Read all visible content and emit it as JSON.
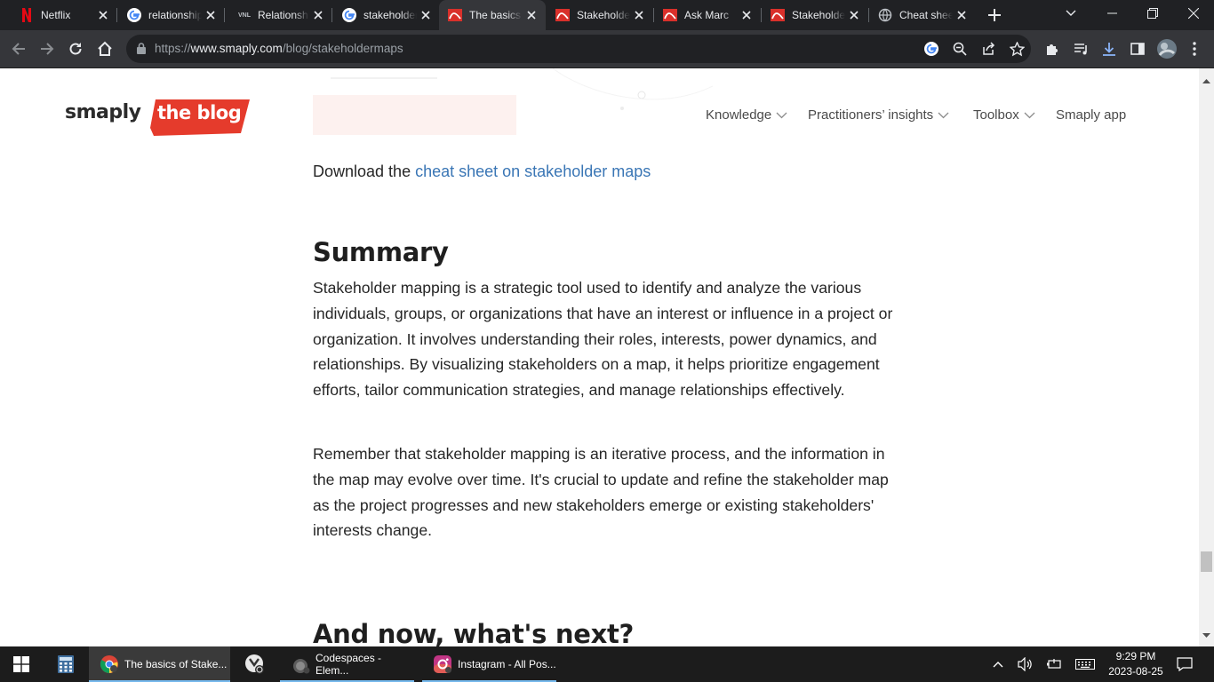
{
  "browser": {
    "tabs": [
      {
        "label": "Netflix",
        "icon": "netflix-icon"
      },
      {
        "label": "relationship",
        "icon": "google-icon"
      },
      {
        "label": "Relationship",
        "icon": "vnl-icon"
      },
      {
        "label": "stakeholder",
        "icon": "google-icon"
      },
      {
        "label": "The basics",
        "icon": "smaply-icon"
      },
      {
        "label": "Stakeholder",
        "icon": "smaply-icon"
      },
      {
        "label": "Ask Marc",
        "icon": "smaply-icon"
      },
      {
        "label": "Stakeholder",
        "icon": "smaply-icon"
      },
      {
        "label": "Cheat sheet",
        "icon": "globe-icon"
      }
    ],
    "vnl_badge": "VNL",
    "active_tab_index": 4,
    "url_prefix": "https://",
    "url_domain": "www.smaply.com",
    "url_path": "/blog/stakeholdermaps"
  },
  "site": {
    "logo_word": "smaply",
    "logo_badge": "the blog",
    "brand_color": "#e53b2c",
    "nav": {
      "knowledge": "Knowledge",
      "practitioners": "Practitioners’ insights",
      "toolbox": "Toolbox",
      "app": "Smaply app"
    }
  },
  "article": {
    "download_prefix": "Download the ",
    "download_link": "cheat sheet on stakeholder maps",
    "summary_heading": "Summary",
    "summary_p1": "Stakeholder mapping is a strategic tool used to identify and analyze the various individuals, groups, or organizations that have an interest or influence in a project or organization. It involves understanding their roles, interests, power dynamics, and relationships. By visualizing stakeholders on a map, it helps prioritize engagement efforts, tailor communication strategies, and manage relationships effectively.",
    "summary_p2": "Remember that stakeholder mapping is an iterative process, and the information in the map may evolve over time. It's crucial to update and refine the stakeholder map as the project progresses and new stakeholders emerge or existing stakeholders' interests change.",
    "next_heading": "And now, what's next?"
  },
  "taskbar": {
    "chrome_label": "The basics of Stake...",
    "codespaces_label": "Codespaces - Elem...",
    "instagram_label": "Instagram - All Pos...",
    "time": "9:29 PM",
    "date": "2023-08-25"
  }
}
